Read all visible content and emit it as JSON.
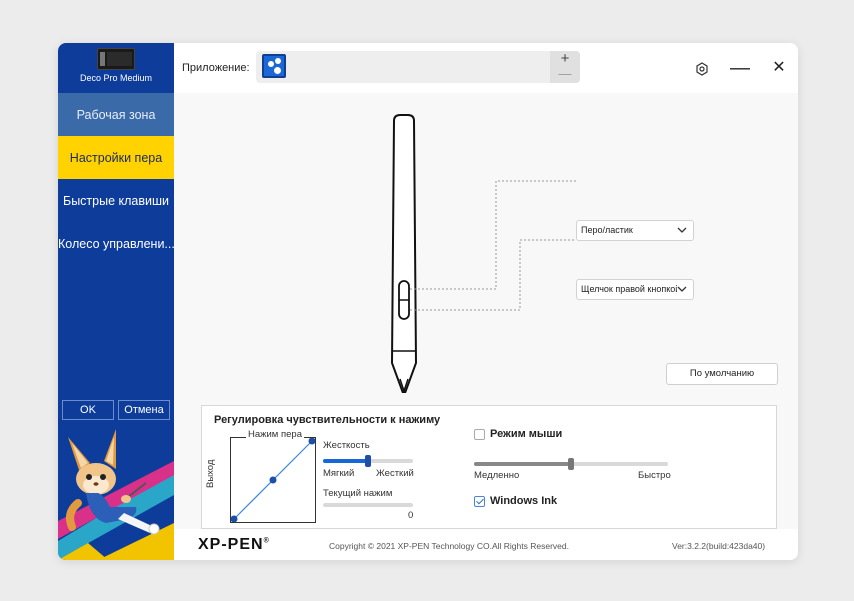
{
  "sidebar": {
    "device_name": "Deco Pro Medium",
    "items": [
      {
        "label": "Рабочая зона"
      },
      {
        "label": "Настройки пера"
      },
      {
        "label": "Быстрые клавиши"
      },
      {
        "label": "Колесо управлени..."
      }
    ],
    "ok_label": "OK",
    "cancel_label": "Отмена"
  },
  "topbar": {
    "app_label": "Приложение:",
    "plus": "+",
    "minus": "—",
    "minimize": "—",
    "close": "✕"
  },
  "pen": {
    "upper_button_value": "Перо/ластик",
    "lower_button_value": "Щелчок правой кнопкой мыши",
    "default_button": "По умолчанию"
  },
  "pressure": {
    "title": "Регулировка чувствительности к нажиму",
    "curve_x_label": "Нажим пера",
    "curve_y_label": "Выход",
    "hardness_label": "Жесткость",
    "soft_label": "Мягкий",
    "hard_label": "Жесткий",
    "hardness_value": 0.5,
    "current_pressure_label": "Текущий нажим",
    "current_pressure_value": "0",
    "mouse_mode_label": "Режим мыши",
    "mouse_mode_checked": false,
    "slow_label": "Медленно",
    "fast_label": "Быстро",
    "mouse_speed_value": 0.5,
    "windows_ink_label": "Windows Ink",
    "windows_ink_checked": true
  },
  "footer": {
    "logo": "XP-PEN",
    "logo_mark": "®",
    "copyright": "Copyright © 2021 XP-PEN Technology CO.All Rights Reserved.",
    "version": "Ver:3.2.2(build:423da40)"
  },
  "colors": {
    "sidebar_bg": "#0d3c9a",
    "active_item_bg": "#ffd200",
    "accent": "#1668d8"
  }
}
